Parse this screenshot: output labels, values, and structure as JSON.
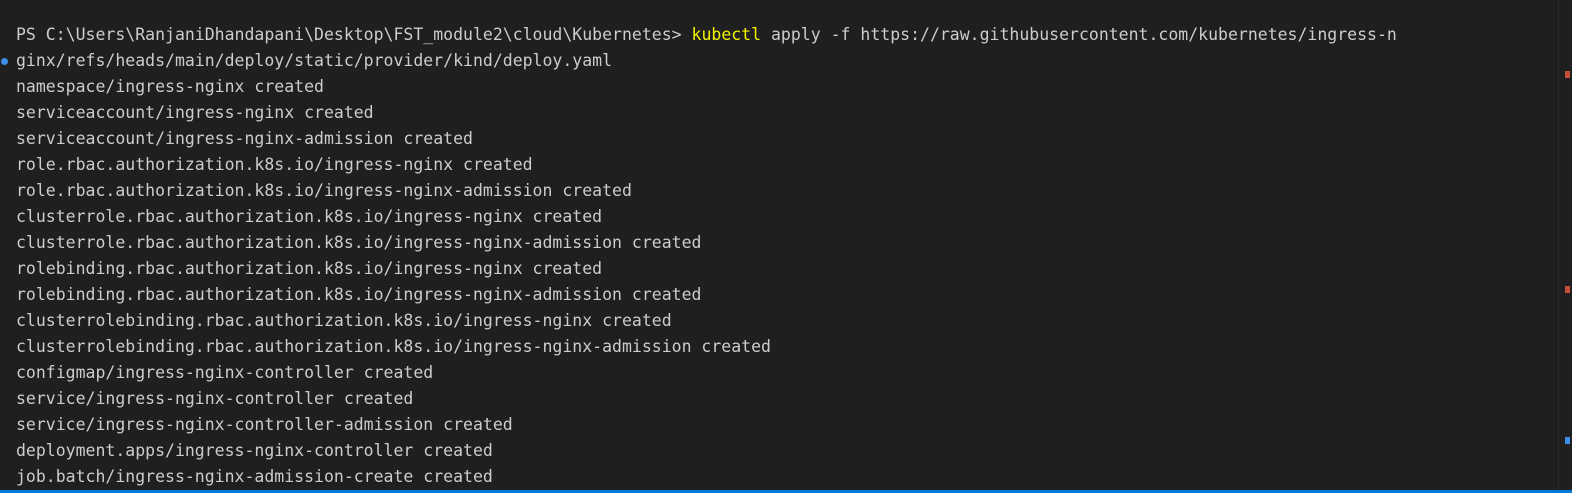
{
  "prompt": {
    "path": "PS C:\\Users\\RanjaniDhandapani\\Desktop\\FST_module2\\cloud\\Kubernetes> ",
    "command": "kubectl",
    "args_line1": " apply -f https://raw.githubusercontent.com/kubernetes/ingress-n",
    "args_line2": "ginx/refs/heads/main/deploy/static/provider/kind/deploy.yaml"
  },
  "output": [
    "namespace/ingress-nginx created",
    "serviceaccount/ingress-nginx created",
    "serviceaccount/ingress-nginx-admission created",
    "role.rbac.authorization.k8s.io/ingress-nginx created",
    "role.rbac.authorization.k8s.io/ingress-nginx-admission created",
    "clusterrole.rbac.authorization.k8s.io/ingress-nginx created",
    "clusterrole.rbac.authorization.k8s.io/ingress-nginx-admission created",
    "rolebinding.rbac.authorization.k8s.io/ingress-nginx created",
    "rolebinding.rbac.authorization.k8s.io/ingress-nginx-admission created",
    "clusterrolebinding.rbac.authorization.k8s.io/ingress-nginx created",
    "clusterrolebinding.rbac.authorization.k8s.io/ingress-nginx-admission created",
    "configmap/ingress-nginx-controller created",
    "service/ingress-nginx-controller created",
    "service/ingress-nginx-controller-admission created",
    "deployment.apps/ingress-nginx-controller created",
    "job.batch/ingress-nginx-admission-create created"
  ],
  "colors": {
    "background": "#1f1f1f",
    "text": "#cccccc",
    "command": "#f2f200",
    "accent": "#0078d4",
    "marker_red": "#c74e39",
    "marker_blue": "#3b8eea"
  }
}
